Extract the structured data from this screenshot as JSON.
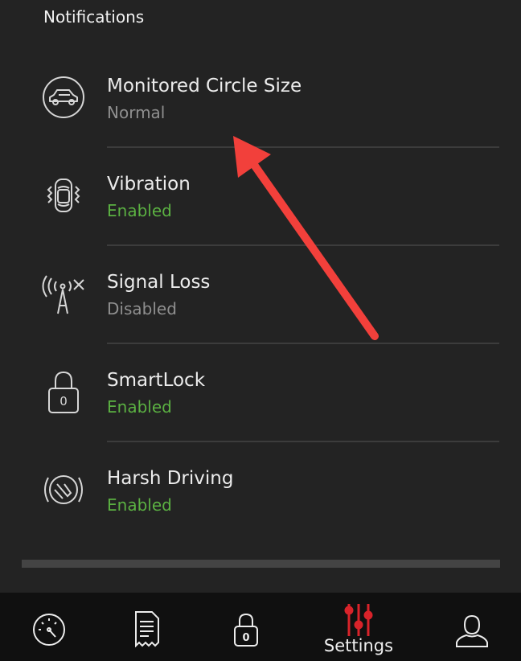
{
  "section": {
    "title": "Notifications"
  },
  "settings": [
    {
      "title": "Monitored Circle Size",
      "status": "Normal",
      "status_type": "neutral",
      "icon": "car-circle-icon"
    },
    {
      "title": "Vibration",
      "status": "Enabled",
      "status_type": "enabled",
      "icon": "car-vibration-icon"
    },
    {
      "title": "Signal Loss",
      "status": "Disabled",
      "status_type": "neutral",
      "icon": "signal-tower-icon"
    },
    {
      "title": "SmartLock",
      "status": "Enabled",
      "status_type": "enabled",
      "icon": "padlock-icon"
    },
    {
      "title": "Harsh Driving",
      "status": "Enabled",
      "status_type": "enabled",
      "icon": "harsh-driving-icon"
    }
  ],
  "nav": {
    "items": [
      {
        "icon": "speedometer-icon",
        "label": ""
      },
      {
        "icon": "receipt-icon",
        "label": ""
      },
      {
        "icon": "lock-icon",
        "label": ""
      },
      {
        "icon": "settings-sliders-icon",
        "label": "Settings",
        "active": true
      },
      {
        "icon": "user-icon",
        "label": ""
      }
    ]
  },
  "colors": {
    "background": "#232323",
    "enabled": "#5bb142",
    "neutral": "#8f8f8f",
    "accent": "#d9232a",
    "annotation_arrow": "#f2403b",
    "nav_background": "#101010"
  }
}
